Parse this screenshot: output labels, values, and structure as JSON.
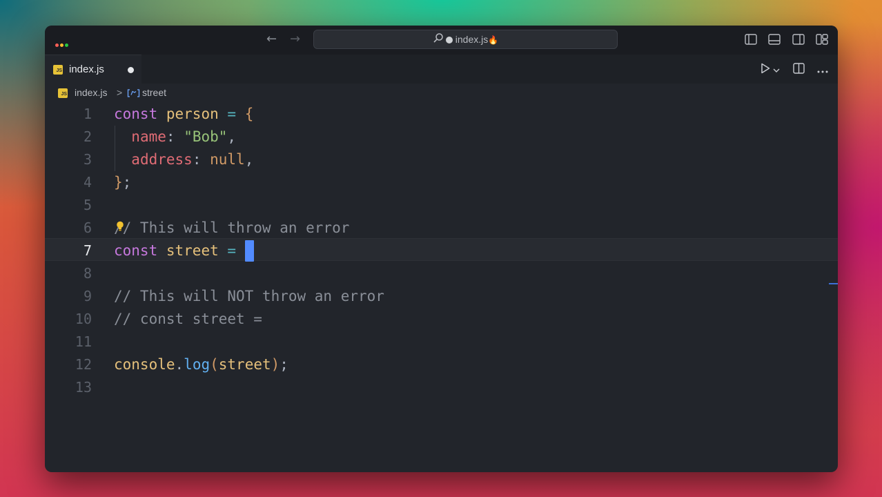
{
  "window": {
    "title": "index.js",
    "title_emoji": "🔥",
    "traffic_lights": [
      "#ff5f57",
      "#febc2e",
      "#28c840"
    ]
  },
  "tab": {
    "label": "index.js",
    "icon": "js-file-icon",
    "modified": true
  },
  "breadcrumb": {
    "file": "index.js",
    "separator": ">",
    "symbol": "street",
    "symbol_icon": "variable-symbol-icon"
  },
  "editor": {
    "active_line": 7,
    "line_numbers": [
      "1",
      "2",
      "3",
      "4",
      "5",
      "6",
      "7",
      "8",
      "9",
      "10",
      "11",
      "12",
      "13"
    ],
    "lines": [
      [
        {
          "t": "const",
          "c": "kw"
        },
        {
          "t": " "
        },
        {
          "t": "person",
          "c": "var"
        },
        {
          "t": " "
        },
        {
          "t": "=",
          "c": "op"
        },
        {
          "t": " "
        },
        {
          "t": "{",
          "c": "brace"
        }
      ],
      [
        {
          "t": "  "
        },
        {
          "t": "name",
          "c": "prop"
        },
        {
          "t": ":",
          "c": "punc"
        },
        {
          "t": " "
        },
        {
          "t": "\"Bob\"",
          "c": "str"
        },
        {
          "t": ",",
          "c": "punc"
        }
      ],
      [
        {
          "t": "  "
        },
        {
          "t": "address",
          "c": "prop"
        },
        {
          "t": ":",
          "c": "punc"
        },
        {
          "t": " "
        },
        {
          "t": "null",
          "c": "null"
        },
        {
          "t": ",",
          "c": "punc"
        }
      ],
      [
        {
          "t": "}",
          "c": "brace"
        },
        {
          "t": ";",
          "c": "punc"
        }
      ],
      [],
      [
        {
          "t": "// This will throw an error",
          "c": "cm"
        }
      ],
      [
        {
          "t": "const",
          "c": "kw"
        },
        {
          "t": " "
        },
        {
          "t": "street",
          "c": "var"
        },
        {
          "t": " "
        },
        {
          "t": "=",
          "c": "op"
        },
        {
          "t": " "
        }
      ],
      [],
      [
        {
          "t": "// This will NOT throw an error",
          "c": "cm"
        }
      ],
      [
        {
          "t": "// const street =",
          "c": "cm"
        }
      ],
      [],
      [
        {
          "t": "console",
          "c": "var"
        },
        {
          "t": ".",
          "c": "punc"
        },
        {
          "t": "log",
          "c": "fn"
        },
        {
          "t": "(",
          "c": "brace"
        },
        {
          "t": "street",
          "c": "var"
        },
        {
          "t": ")",
          "c": "brace"
        },
        {
          "t": ";",
          "c": "punc"
        }
      ],
      []
    ]
  },
  "icons": {
    "back": "arrow-left-icon",
    "forward": "arrow-right-icon",
    "search": "search-icon",
    "lightbulb": "lightbulb-icon",
    "run": "play-icon",
    "split": "split-editor-icon",
    "more": "more-icon"
  }
}
